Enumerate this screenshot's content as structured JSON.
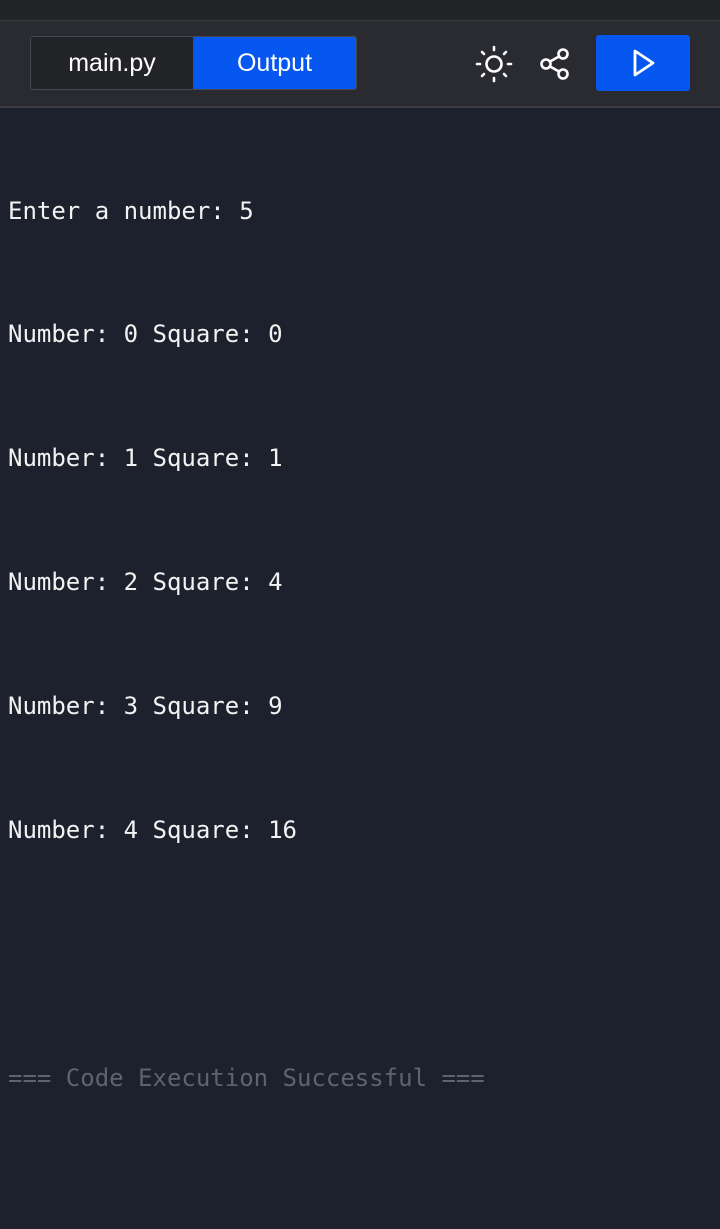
{
  "tabs": {
    "file_label": "main.py",
    "output_label": "Output"
  },
  "toolbar": {
    "theme_icon": "sun-icon",
    "share_icon": "share-icon",
    "run_icon": "play-icon"
  },
  "colors": {
    "accent": "#0557f0",
    "background": "#1d212d",
    "toolbar": "#2a2b31",
    "status_text": "#5f636d"
  },
  "output": {
    "lines": [
      "Enter a number: 5",
      "Number: 0 Square: 0",
      "Number: 1 Square: 1",
      "Number: 2 Square: 4",
      "Number: 3 Square: 9",
      "Number: 4 Square: 16"
    ],
    "status": "=== Code Execution Successful ==="
  }
}
